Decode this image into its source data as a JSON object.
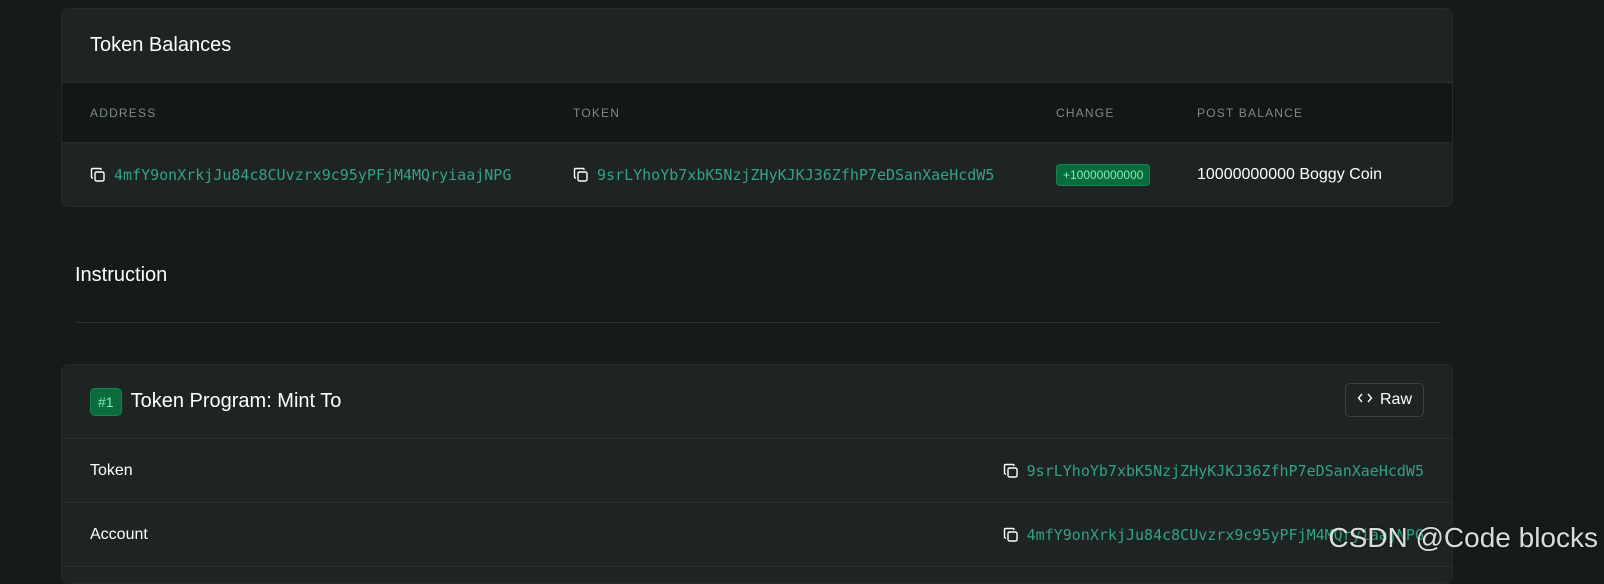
{
  "token_balances": {
    "title": "Token Balances",
    "columns": [
      "ADDRESS",
      "TOKEN",
      "CHANGE",
      "POST BALANCE"
    ],
    "rows": [
      {
        "address": "4mfY9onXrkjJu84c8CUvzrx9c95yPFjM4MQryiaajNPG",
        "token": "9srLYhoYb7xbK5NzjZHyKJKJ36ZfhP7eDSanXaeHcdW5",
        "change": "+10000000000",
        "post_balance": "10000000000 Boggy Coin"
      }
    ]
  },
  "section": {
    "title": "Instruction"
  },
  "instruction": {
    "number": "#1",
    "title": "Token Program: Mint To",
    "raw_label": "Raw",
    "fields": [
      {
        "label": "Token",
        "value": "9srLYhoYb7xbK5NzjZHyKJKJ36ZfhP7eDSanXaeHcdW5"
      },
      {
        "label": "Account",
        "value": "4mfY9onXrkjJu84c8CUvzrx9c95yPFjM4MQryiaajNPG"
      }
    ]
  },
  "watermark": "CSDN @Code blocks",
  "colors": {
    "background": "#161a1a",
    "card": "#1e2323",
    "accent_text": "#33a382",
    "badge_bg": "#0a6b3c",
    "badge_text": "#7ff0b5"
  },
  "icons": {
    "copy": "copy-icon",
    "code": "code-icon"
  }
}
